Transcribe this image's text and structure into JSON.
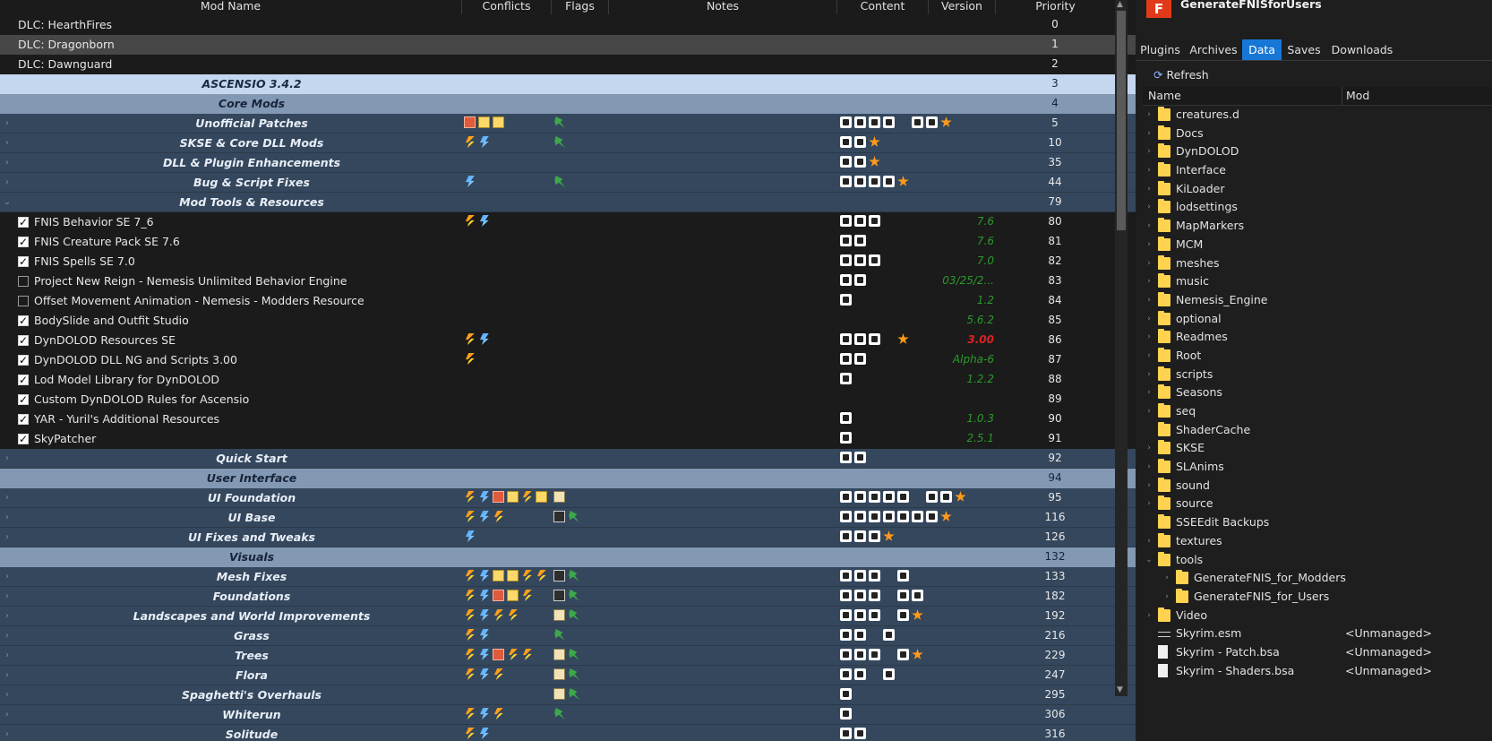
{
  "columns": {
    "mod_name": "Mod Name",
    "conflicts": "Conflicts",
    "flags": "Flags",
    "notes": "Notes",
    "content": "Content",
    "version": "Version",
    "priority": "Priority"
  },
  "rows": [
    {
      "type": "plain",
      "name": "DLC: HearthFires",
      "priority": "0"
    },
    {
      "type": "selected",
      "name": "DLC: Dragonborn",
      "priority": "1"
    },
    {
      "type": "plain",
      "name": "DLC: Dawnguard",
      "priority": "2"
    },
    {
      "type": "sep-light",
      "name": "ASCENSIO 3.4.2",
      "priority": "3"
    },
    {
      "type": "sep-mid",
      "name": "Core Mods",
      "priority": "4"
    },
    {
      "type": "sep",
      "expand": "›",
      "name": "Unofficial Patches",
      "priority": "5",
      "conf": [
        "box-r",
        "box-y",
        "box-y"
      ],
      "flags": [
        "pin"
      ],
      "content": [
        "cnt",
        "cnt",
        "cnt",
        "cnt",
        "chk2",
        "cnt",
        "cnt",
        "star"
      ]
    },
    {
      "type": "sep",
      "expand": "›",
      "name": "SKSE & Core DLL Mods",
      "priority": "10",
      "conf": [
        "bolt-o",
        "bolt-b"
      ],
      "flags": [
        "pin"
      ],
      "content": [
        "cnt",
        "cnt",
        "star"
      ]
    },
    {
      "type": "sep",
      "expand": "›",
      "name": "DLL & Plugin Enhancements",
      "priority": "35",
      "content": [
        "cnt",
        "cnt",
        "star"
      ]
    },
    {
      "type": "sep",
      "expand": "›",
      "name": "Bug & Script Fixes",
      "priority": "44",
      "conf": [
        "bolt-b"
      ],
      "flags": [
        "pin"
      ],
      "content": [
        "cnt",
        "cnt",
        "cnt",
        "cnt",
        "star"
      ]
    },
    {
      "type": "sep",
      "expand": "⌄",
      "name": "Mod Tools & Resources",
      "priority": "79"
    },
    {
      "type": "mod",
      "checked": true,
      "name": "FNIS Behavior SE 7_6",
      "priority": "80",
      "conf": [
        "bolt-o",
        "bolt-b"
      ],
      "content": [
        "cnt",
        "cnt",
        "cnt"
      ],
      "version": "7.6"
    },
    {
      "type": "mod",
      "checked": true,
      "name": "FNIS Creature Pack SE 7.6",
      "priority": "81",
      "content": [
        "cnt",
        "cnt"
      ],
      "version": "7.6"
    },
    {
      "type": "mod",
      "checked": true,
      "name": "FNIS Spells SE 7.0",
      "priority": "82",
      "content": [
        "cnt",
        "cnt",
        "cnt"
      ],
      "version": "7.0"
    },
    {
      "type": "mod",
      "checked": false,
      "name": "Project New Reign - Nemesis Unlimited Behavior Engine",
      "priority": "83",
      "content": [
        "cnt",
        "cnt"
      ],
      "version": "03/25/2..."
    },
    {
      "type": "mod",
      "checked": false,
      "name": "Offset Movement Animation - Nemesis - Modders Resource",
      "priority": "84",
      "content": [
        "cnt"
      ],
      "version": "1.2"
    },
    {
      "type": "mod",
      "checked": true,
      "name": "BodySlide and Outfit Studio",
      "priority": "85",
      "version": "5.6.2"
    },
    {
      "type": "mod",
      "checked": true,
      "name": "DynDOLOD Resources SE",
      "priority": "86",
      "conf": [
        "bolt-o",
        "bolt-b"
      ],
      "content": [
        "cnt",
        "cnt",
        "cnt",
        "chk2",
        "star"
      ],
      "version": "3.00",
      "version_red": true
    },
    {
      "type": "mod",
      "checked": true,
      "name": "DynDOLOD DLL NG and Scripts 3.00",
      "priority": "87",
      "conf": [
        "bolt-o"
      ],
      "content": [
        "cnt",
        "cnt"
      ],
      "version": "Alpha-6"
    },
    {
      "type": "mod",
      "checked": true,
      "name": "Lod Model Library for DynDOLOD",
      "priority": "88",
      "content": [
        "cnt"
      ],
      "version": "1.2.2"
    },
    {
      "type": "mod",
      "checked": true,
      "name": "Custom DynDOLOD Rules for Ascensio",
      "priority": "89"
    },
    {
      "type": "mod",
      "checked": true,
      "name": "YAR - Yuril's Additional Resources",
      "priority": "90",
      "content": [
        "cnt",
        "chk2"
      ],
      "version": "1.0.3"
    },
    {
      "type": "mod",
      "checked": true,
      "name": "SkyPatcher",
      "priority": "91",
      "content": [
        "cnt"
      ],
      "version": "2.5.1"
    },
    {
      "type": "sep",
      "expand": "›",
      "name": "Quick Start",
      "priority": "92",
      "content": [
        "cnt",
        "cnt"
      ]
    },
    {
      "type": "sep-mid",
      "name": "User Interface",
      "priority": "94"
    },
    {
      "type": "sep",
      "expand": "›",
      "name": "UI Foundation",
      "priority": "95",
      "conf": [
        "bolt-o",
        "bolt-b",
        "box-r",
        "box-y",
        "bolt-o",
        "box-y"
      ],
      "flags": [
        "note"
      ],
      "content": [
        "cnt",
        "cnt",
        "cnt",
        "cnt",
        "cnt",
        "chk2",
        "cnt",
        "cnt",
        "star"
      ]
    },
    {
      "type": "sep",
      "expand": "›",
      "name": "UI Base",
      "priority": "116",
      "conf": [
        "bolt-o",
        "bolt-b",
        "bolt-o"
      ],
      "flags": [
        "doc",
        "pin"
      ],
      "content": [
        "cnt",
        "cnt",
        "cnt",
        "cnt",
        "cnt",
        "cnt",
        "cnt",
        "star"
      ]
    },
    {
      "type": "sep",
      "expand": "›",
      "name": "UI Fixes and Tweaks",
      "priority": "126",
      "conf": [
        "bolt-b"
      ],
      "content": [
        "cnt",
        "cnt",
        "cnt",
        "star"
      ]
    },
    {
      "type": "sep-mid",
      "name": "Visuals",
      "priority": "132"
    },
    {
      "type": "sep",
      "expand": "›",
      "name": "Mesh Fixes",
      "priority": "133",
      "conf": [
        "bolt-o",
        "bolt-b",
        "box-y",
        "box-y",
        "bolt-o",
        "bolt-o"
      ],
      "flags": [
        "doc",
        "pin"
      ],
      "content": [
        "cnt",
        "cnt",
        "cnt",
        "chk2",
        "cnt"
      ]
    },
    {
      "type": "sep",
      "expand": "›",
      "name": "Foundations",
      "priority": "182",
      "conf": [
        "bolt-o",
        "bolt-b",
        "box-r",
        "box-y",
        "bolt-o"
      ],
      "flags": [
        "doc",
        "pin"
      ],
      "content": [
        "cnt",
        "cnt",
        "cnt",
        "chk2",
        "cnt",
        "cnt"
      ]
    },
    {
      "type": "sep",
      "expand": "›",
      "name": "Landscapes and World Improvements",
      "priority": "192",
      "conf": [
        "bolt-o",
        "bolt-b",
        "bolt-o",
        "bolt-o"
      ],
      "flags": [
        "note",
        "pin"
      ],
      "content": [
        "cnt",
        "cnt",
        "cnt",
        "chk2",
        "cnt",
        "star"
      ]
    },
    {
      "type": "sep",
      "expand": "›",
      "name": "Grass",
      "priority": "216",
      "conf": [
        "bolt-o",
        "bolt-b"
      ],
      "flags": [
        "pin"
      ],
      "content": [
        "cnt",
        "cnt",
        "chk2",
        "cnt"
      ]
    },
    {
      "type": "sep",
      "expand": "›",
      "name": "Trees",
      "priority": "229",
      "conf": [
        "bolt-o",
        "bolt-b",
        "box-r",
        "bolt-o",
        "bolt-o"
      ],
      "flags": [
        "note",
        "pin"
      ],
      "content": [
        "cnt",
        "cnt",
        "cnt",
        "chk2",
        "cnt",
        "star"
      ]
    },
    {
      "type": "sep",
      "expand": "›",
      "name": "Flora",
      "priority": "247",
      "conf": [
        "bolt-o",
        "bolt-b",
        "bolt-o"
      ],
      "flags": [
        "note",
        "pin"
      ],
      "content": [
        "cnt",
        "cnt",
        "chk2",
        "cnt"
      ]
    },
    {
      "type": "sep",
      "expand": "›",
      "name": "Spaghetti's Overhauls",
      "priority": "295",
      "flags": [
        "note",
        "pin"
      ],
      "content": [
        "cnt"
      ]
    },
    {
      "type": "sep",
      "expand": "›",
      "name": "Whiterun",
      "priority": "306",
      "conf": [
        "bolt-o",
        "bolt-b",
        "bolt-o"
      ],
      "flags": [
        "pin"
      ],
      "content": [
        "cnt",
        "chk2"
      ]
    },
    {
      "type": "sep",
      "expand": "›",
      "name": "Solitude",
      "priority": "316",
      "conf": [
        "bolt-o",
        "bolt-b"
      ],
      "content": [
        "cnt",
        "cnt",
        "chk2"
      ]
    }
  ],
  "profile": {
    "title": "GenerateFNISforUsers",
    "logo_letter": "F"
  },
  "tabs": [
    {
      "label": "Plugins",
      "active": false
    },
    {
      "label": "Archives",
      "active": false
    },
    {
      "label": "Data",
      "active": true
    },
    {
      "label": "Saves",
      "active": false
    },
    {
      "label": "Downloads",
      "active": false
    }
  ],
  "refresh_label": "Refresh",
  "tree_columns": {
    "name": "Name",
    "mod": "Mod"
  },
  "tree": [
    {
      "kind": "folder",
      "name": "creatures.d",
      "depth": 0
    },
    {
      "kind": "folder",
      "name": "Docs",
      "depth": 0
    },
    {
      "kind": "folder",
      "name": "DynDOLOD",
      "depth": 0
    },
    {
      "kind": "folder",
      "name": "Interface",
      "depth": 0
    },
    {
      "kind": "folder",
      "name": "KiLoader",
      "depth": 0
    },
    {
      "kind": "folder",
      "name": "lodsettings",
      "depth": 0
    },
    {
      "kind": "folder",
      "name": "MapMarkers",
      "depth": 0
    },
    {
      "kind": "folder",
      "name": "MCM",
      "depth": 0
    },
    {
      "kind": "folder",
      "name": "meshes",
      "depth": 0
    },
    {
      "kind": "folder",
      "name": "music",
      "depth": 0
    },
    {
      "kind": "folder",
      "name": "Nemesis_Engine",
      "depth": 0
    },
    {
      "kind": "folder",
      "name": "optional",
      "depth": 0
    },
    {
      "kind": "folder",
      "name": "Readmes",
      "depth": 0
    },
    {
      "kind": "folder",
      "name": "Root",
      "depth": 0
    },
    {
      "kind": "folder",
      "name": "scripts",
      "depth": 0
    },
    {
      "kind": "folder",
      "name": "Seasons",
      "depth": 0
    },
    {
      "kind": "folder",
      "name": "seq",
      "depth": 0
    },
    {
      "kind": "folder",
      "name": "ShaderCache",
      "depth": 0,
      "noarrow": true
    },
    {
      "kind": "folder",
      "name": "SKSE",
      "depth": 0
    },
    {
      "kind": "folder",
      "name": "SLAnims",
      "depth": 0
    },
    {
      "kind": "folder",
      "name": "sound",
      "depth": 0
    },
    {
      "kind": "folder",
      "name": "source",
      "depth": 0
    },
    {
      "kind": "folder",
      "name": "SSEEdit Backups",
      "depth": 0,
      "noarrow": true
    },
    {
      "kind": "folder",
      "name": "textures",
      "depth": 0
    },
    {
      "kind": "folder",
      "name": "tools",
      "depth": 0,
      "open": true
    },
    {
      "kind": "folder",
      "name": "GenerateFNIS_for_Modders",
      "depth": 1
    },
    {
      "kind": "folder",
      "name": "GenerateFNIS_for_Users",
      "depth": 1
    },
    {
      "kind": "folder",
      "name": "Video",
      "depth": 0
    },
    {
      "kind": "esp",
      "name": "Skyrim.esm",
      "depth": 0,
      "mod": "<Unmanaged>"
    },
    {
      "kind": "file",
      "name": "Skyrim - Patch.bsa",
      "depth": 0,
      "mod": "<Unmanaged>"
    },
    {
      "kind": "file",
      "name": "Skyrim - Shaders.bsa",
      "depth": 0,
      "mod": "<Unmanaged>"
    }
  ]
}
